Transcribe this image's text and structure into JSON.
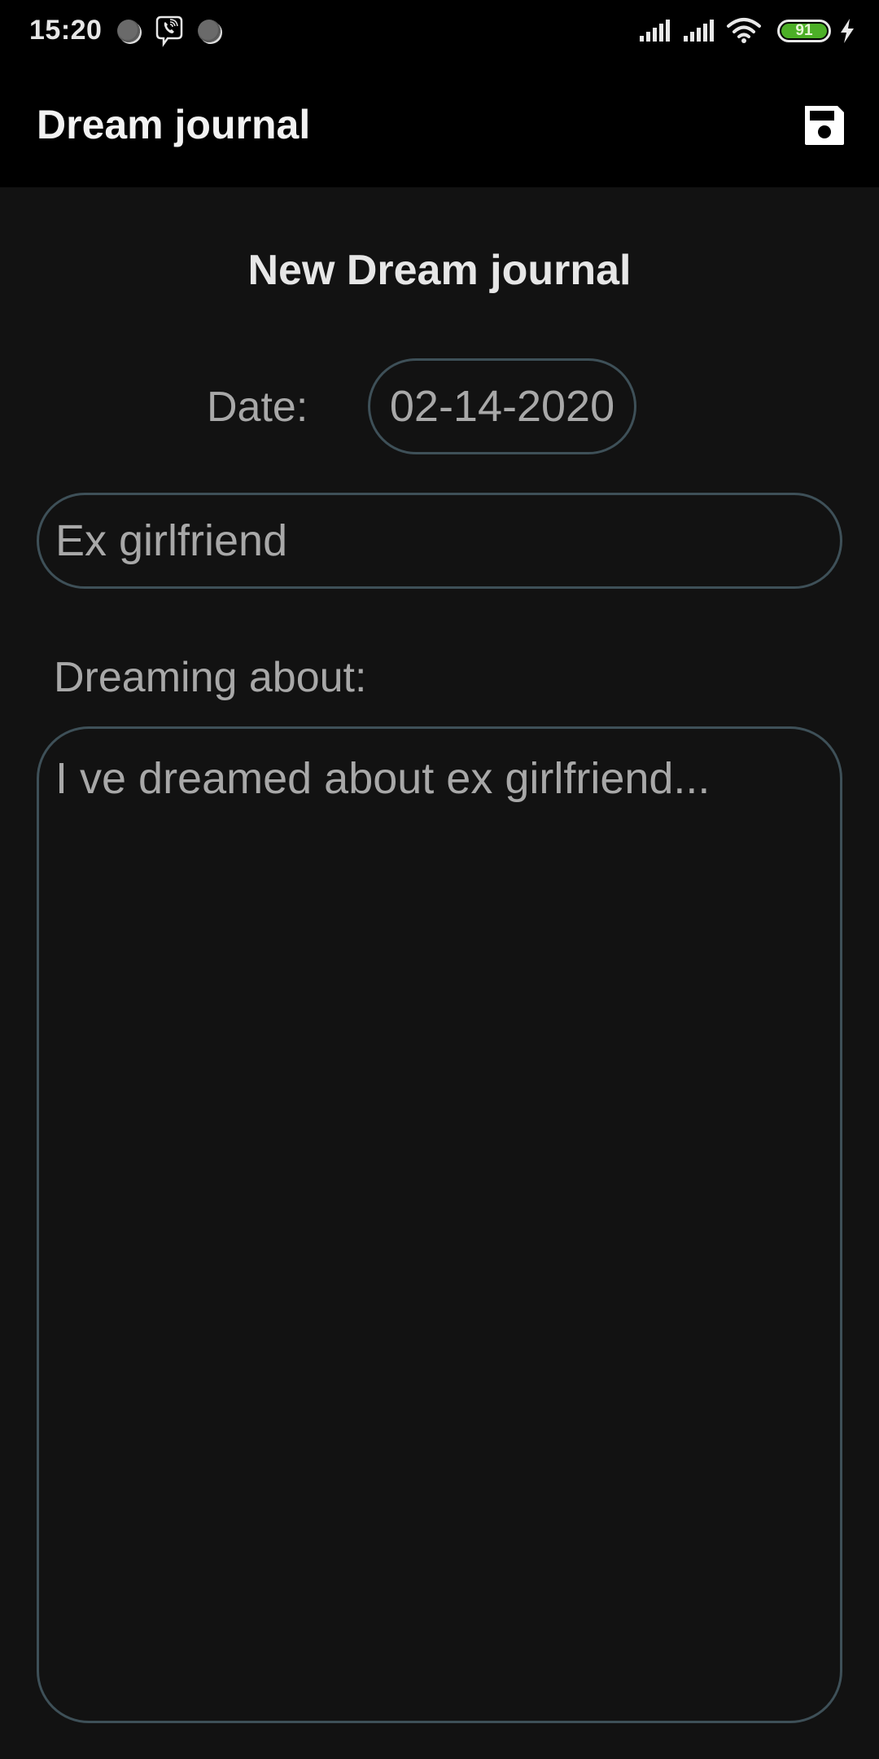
{
  "status_bar": {
    "time": "15:20",
    "notification_icons": [
      "notification-dot-icon",
      "viber-icon",
      "notification-dot-icon"
    ],
    "battery_level": "91",
    "battery_color": "#4caf27",
    "charging": true
  },
  "app_bar": {
    "title": "Dream journal",
    "save_icon": "floppy-disk-icon"
  },
  "form": {
    "title": "New Dream journal",
    "date_label": "Date:",
    "date_value": "02-14-2020",
    "title_field_value": "Ex girlfriend",
    "dreaming_label": "Dreaming about:",
    "dreaming_value": "I ve dreamed about ex girlfriend..."
  },
  "colors": {
    "background": "#121212",
    "app_bar": "#000000",
    "field_border": "#3e5058",
    "field_text": "#a8a8a8"
  }
}
